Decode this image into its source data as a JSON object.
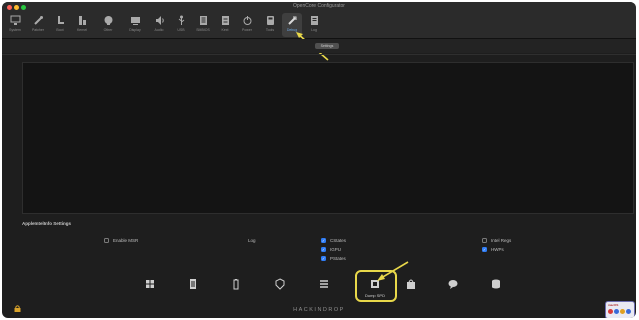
{
  "window": {
    "title": "OpenCore Configurator"
  },
  "toolbar": {
    "items": [
      {
        "label": "System",
        "icon": "monitor-icon"
      },
      {
        "label": "Patcher",
        "icon": "wrench-icon"
      },
      {
        "label": "Boot",
        "icon": "boot-icon"
      },
      {
        "label": "Kernel",
        "icon": "kernel-icon"
      },
      {
        "label": "Other",
        "icon": "puzzle-icon"
      },
      {
        "label": "Display",
        "icon": "display-icon"
      },
      {
        "label": "Audio",
        "icon": "speaker-icon"
      },
      {
        "label": "USB",
        "icon": "usb-icon"
      },
      {
        "label": "SMBIOS",
        "icon": "document-icon"
      },
      {
        "label": "Kext",
        "icon": "kext-icon"
      },
      {
        "label": "Power",
        "icon": "power-icon"
      },
      {
        "label": "Tools",
        "icon": "tools-icon"
      },
      {
        "label": "Debug",
        "icon": "debug-icon"
      },
      {
        "label": "Log",
        "icon": "log-icon"
      }
    ],
    "selected_index": 12
  },
  "subbar": {
    "button_label": "Settings"
  },
  "settings": {
    "title": "AppleIntelInfo Settings",
    "enable_msr": {
      "label": "Enable MSR",
      "checked": false
    },
    "log_label": "Log",
    "cstates": {
      "label": "CStates",
      "checked": true
    },
    "ifsr": {
      "label": "IGPU",
      "checked": true
    },
    "pstates": {
      "label": "PStates",
      "checked": true
    },
    "hwp": {
      "label": "Intel Regs",
      "checked": false
    },
    "hwps": {
      "label": "HWPs",
      "checked": true
    }
  },
  "bottom_actions": [
    {
      "icon": "grid-icon",
      "label": ""
    },
    {
      "icon": "clipboard-icon",
      "label": ""
    },
    {
      "icon": "battery-icon",
      "label": ""
    },
    {
      "icon": "shield-icon",
      "label": ""
    },
    {
      "icon": "list-icon",
      "label": ""
    },
    {
      "icon": "chip-icon",
      "label": "Dump SPD"
    },
    {
      "icon": "bag-icon",
      "label": ""
    },
    {
      "icon": "chat-icon",
      "label": ""
    },
    {
      "icon": "database-icon",
      "label": ""
    }
  ],
  "footer": {
    "brand": "HACKINDROP",
    "badge_text": "macOS"
  },
  "colors": {
    "accent": "#2f7df6",
    "highlight": "#e8d84a",
    "background": "#1e1e1e"
  }
}
